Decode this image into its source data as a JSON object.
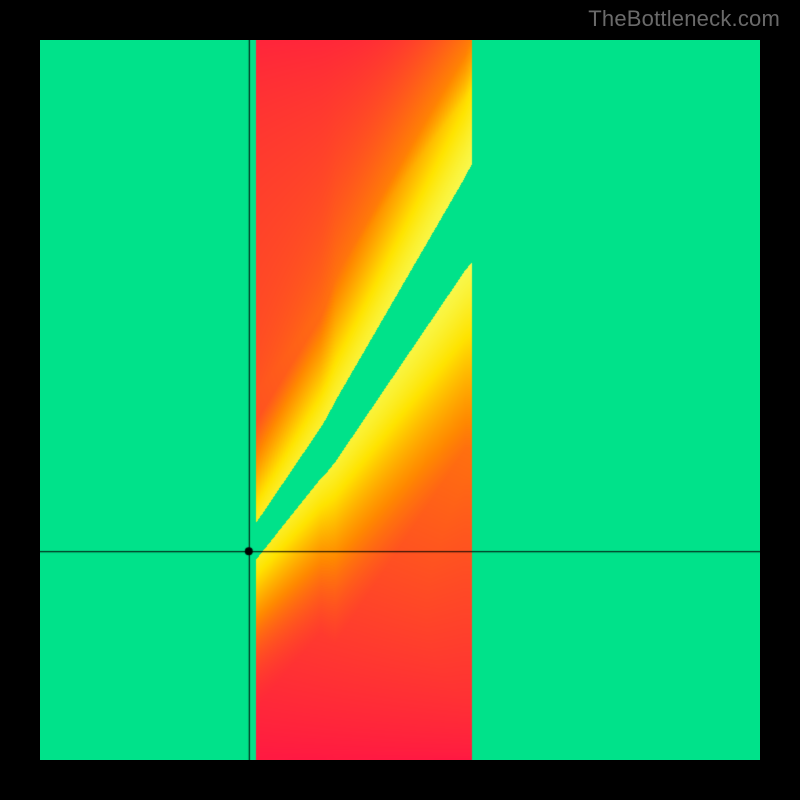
{
  "watermark": "TheBottleneck.com",
  "chart_data": {
    "type": "heatmap",
    "title": "",
    "xlabel": "",
    "ylabel": "",
    "xlim": [
      0,
      1
    ],
    "ylim": [
      0,
      1
    ],
    "crosshair": {
      "x": 0.29,
      "y": 0.29
    },
    "marker": {
      "x": 0.29,
      "y": 0.29,
      "radius": 4,
      "color": "#000000"
    },
    "ridge": {
      "description": "Optimal-match ridge (green) from bottom-left to top-right; slope steeper than 1.",
      "points_xy": [
        [
          0.0,
          0.0
        ],
        [
          0.1,
          0.08
        ],
        [
          0.2,
          0.18
        ],
        [
          0.29,
          0.29
        ],
        [
          0.4,
          0.44
        ],
        [
          0.5,
          0.6
        ],
        [
          0.6,
          0.76
        ],
        [
          0.68,
          0.9
        ],
        [
          0.74,
          1.0
        ]
      ],
      "half_width_fraction_at": {
        "0.0": 0.005,
        "0.3": 0.015,
        "0.6": 0.035,
        "1.0": 0.06
      }
    },
    "color_stops": [
      {
        "t": 0.0,
        "color": "#ff1744"
      },
      {
        "t": 0.33,
        "color": "#ff8a00"
      },
      {
        "t": 0.62,
        "color": "#ffe400"
      },
      {
        "t": 0.9,
        "color": "#f7ff66"
      },
      {
        "t": 1.0,
        "color": "#00e28a"
      }
    ],
    "axes_drawn": false,
    "grid": false,
    "legend": false
  }
}
